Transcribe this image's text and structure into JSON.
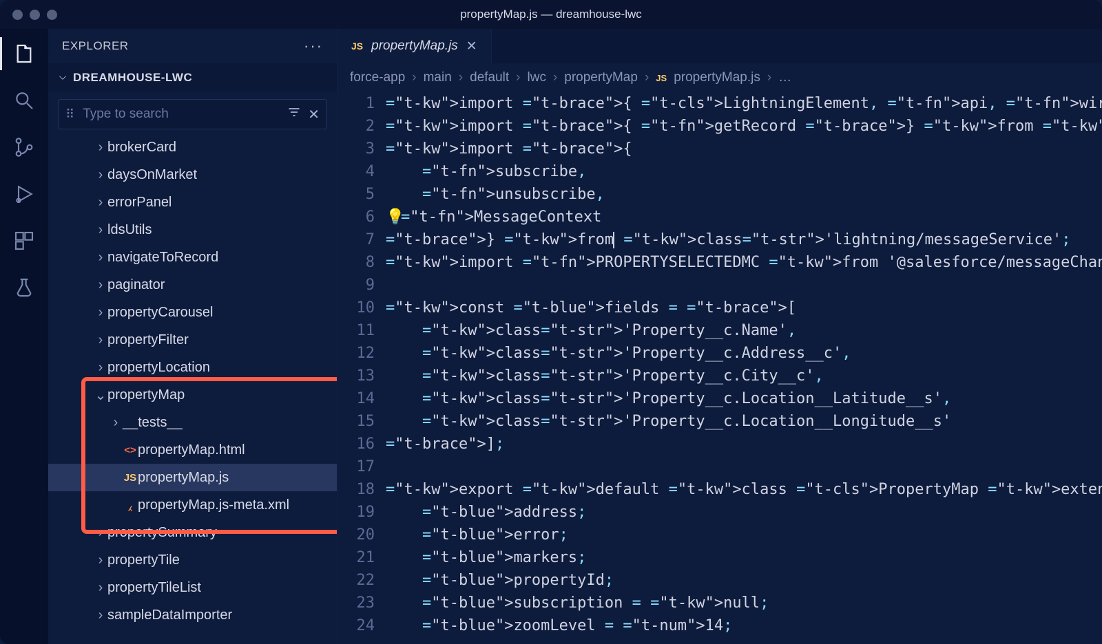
{
  "window": {
    "title": "propertyMap.js — dreamhouse-lwc"
  },
  "sidebar": {
    "header": "EXPLORER",
    "section": "DREAMHOUSE-LWC",
    "search_placeholder": "Type to search",
    "tree": [
      {
        "label": "brokerCard",
        "depth": 3,
        "chev": ">",
        "icon": ""
      },
      {
        "label": "daysOnMarket",
        "depth": 3,
        "chev": ">",
        "icon": ""
      },
      {
        "label": "errorPanel",
        "depth": 3,
        "chev": ">",
        "icon": ""
      },
      {
        "label": "ldsUtils",
        "depth": 3,
        "chev": ">",
        "icon": ""
      },
      {
        "label": "navigateToRecord",
        "depth": 3,
        "chev": ">",
        "icon": ""
      },
      {
        "label": "paginator",
        "depth": 3,
        "chev": ">",
        "icon": ""
      },
      {
        "label": "propertyCarousel",
        "depth": 3,
        "chev": ">",
        "icon": ""
      },
      {
        "label": "propertyFilter",
        "depth": 3,
        "chev": ">",
        "icon": ""
      },
      {
        "label": "propertyLocation",
        "depth": 3,
        "chev": ">",
        "icon": ""
      },
      {
        "label": "propertyMap",
        "depth": 3,
        "chev": "v",
        "icon": ""
      },
      {
        "label": "__tests__",
        "depth": 4,
        "chev": ">",
        "icon": ""
      },
      {
        "label": "propertyMap.html",
        "depth": 4,
        "chev": "",
        "icon": "html"
      },
      {
        "label": "propertyMap.js",
        "depth": 4,
        "chev": "",
        "icon": "js",
        "selected": true
      },
      {
        "label": "propertyMap.js-meta.xml",
        "depth": 4,
        "chev": "",
        "icon": "xml"
      },
      {
        "label": "propertySummary",
        "depth": 3,
        "chev": ">",
        "icon": ""
      },
      {
        "label": "propertyTile",
        "depth": 3,
        "chev": ">",
        "icon": ""
      },
      {
        "label": "propertyTileList",
        "depth": 3,
        "chev": ">",
        "icon": ""
      },
      {
        "label": "sampleDataImporter",
        "depth": 3,
        "chev": ">",
        "icon": ""
      }
    ]
  },
  "tab": {
    "icon": "JS",
    "label": "propertyMap.js"
  },
  "breadcrumb": [
    "force-app",
    "main",
    "default",
    "lwc",
    "propertyMap",
    "propertyMap.js",
    "…"
  ],
  "code": {
    "lines": [
      "import { LightningElement, api, wire } from 'lwc';",
      "import { getRecord } from 'lightning/uiRecordApi';",
      "import {",
      "    subscribe,",
      "    unsubscribe,",
      "    MessageContext",
      "} from 'lightning/messageService';",
      "import PROPERTYSELECTEDMC from '@salesforce/messageChannel/PropertySelecte",
      "",
      "const fields = [",
      "    'Property__c.Name',",
      "    'Property__c.Address__c',",
      "    'Property__c.City__c',",
      "    'Property__c.Location__Latitude__s',",
      "    'Property__c.Location__Longitude__s'",
      "];",
      "",
      "export default class PropertyMap extends LightningElement {",
      "    address;",
      "    error;",
      "    markers;",
      "    propertyId;",
      "    subscription = null;",
      "    zoomLevel = 14;"
    ]
  }
}
